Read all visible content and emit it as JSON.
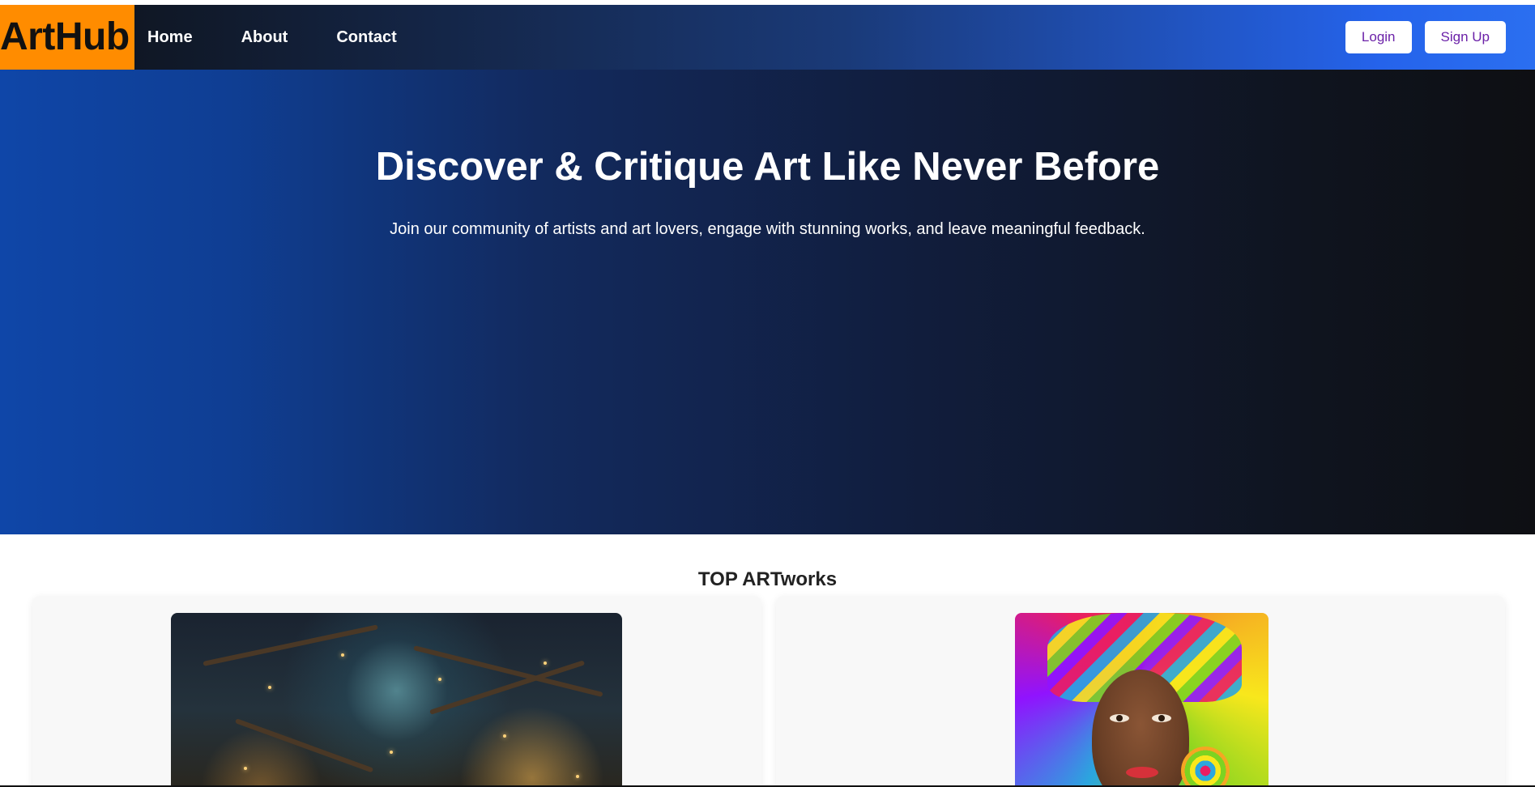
{
  "brand": {
    "logo": "ArtHub",
    "accent": "#ff8c00"
  },
  "nav": {
    "links": [
      "Home",
      "About",
      "Contact"
    ],
    "login_label": "Login",
    "signup_label": "Sign Up",
    "button_text_color": "#6b21a8"
  },
  "hero": {
    "title": "Discover & Critique Art Like Never Before",
    "subtitle": "Join our community of artists and art lovers, engage with stunning works, and leave meaningful feedback."
  },
  "artworks": {
    "section_title": "TOP ARTworks",
    "items": [
      {
        "subject": "enchanted-forest"
      },
      {
        "subject": "colorful-portrait"
      }
    ]
  }
}
